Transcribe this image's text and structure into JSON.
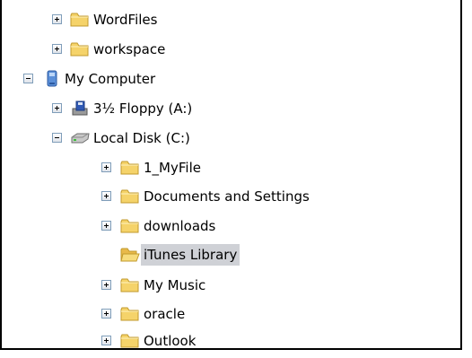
{
  "tree": {
    "items": [
      {
        "label": "WordFiles",
        "icon": "folder-icon",
        "expander": "plus"
      },
      {
        "label": "workspace",
        "icon": "folder-icon",
        "expander": "plus"
      },
      {
        "label": "My Computer",
        "icon": "computer-icon",
        "expander": "minus"
      },
      {
        "label": "3½ Floppy (A:)",
        "icon": "floppy-drive-icon",
        "expander": "plus"
      },
      {
        "label": "Local Disk (C:)",
        "icon": "hard-disk-icon",
        "expander": "minus"
      },
      {
        "label": "1_MyFile",
        "icon": "folder-icon",
        "expander": "plus"
      },
      {
        "label": "Documents and Settings",
        "icon": "folder-icon",
        "expander": "plus"
      },
      {
        "label": "downloads",
        "icon": "folder-icon",
        "expander": "plus"
      },
      {
        "label": "iTunes Library",
        "icon": "folder-open-icon",
        "expander": "none",
        "selected": true
      },
      {
        "label": "My Music",
        "icon": "folder-icon",
        "expander": "plus"
      },
      {
        "label": "oracle",
        "icon": "folder-icon",
        "expander": "plus"
      },
      {
        "label": "Outlook",
        "icon": "folder-icon",
        "expander": "plus"
      }
    ]
  },
  "colors": {
    "selection": "#cfd1d6",
    "folder": "#f5d36a",
    "expander_border": "#7f9db9"
  }
}
